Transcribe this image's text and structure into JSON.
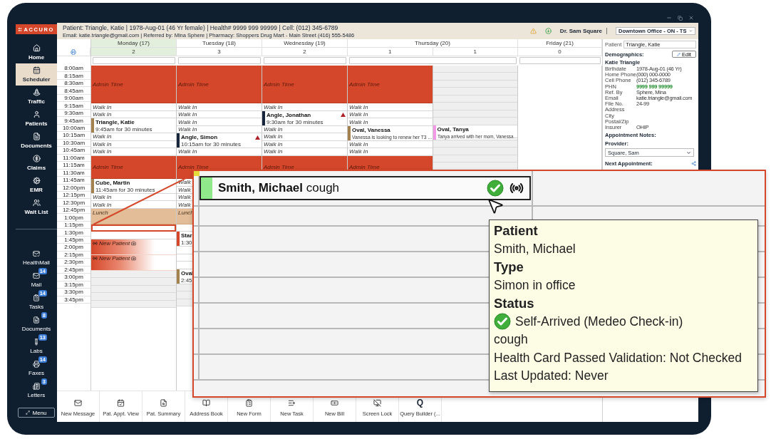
{
  "sidebar": {
    "logo": "ACCURO",
    "nav": [
      {
        "label": "Home",
        "selected": false
      },
      {
        "label": "Scheduler",
        "selected": true
      },
      {
        "label": "Traffic",
        "selected": false
      },
      {
        "label": "Patients",
        "selected": false
      },
      {
        "label": "Documents",
        "selected": false
      },
      {
        "label": "Claims",
        "selected": false
      },
      {
        "label": "EMR",
        "selected": false
      },
      {
        "label": "Wait List",
        "selected": false
      }
    ],
    "inbox": [
      {
        "label": "HealthMail"
      },
      {
        "label": "Mail",
        "badge": "14"
      },
      {
        "label": "Tasks",
        "badge": "14"
      },
      {
        "label": "Documents",
        "badge": "8"
      },
      {
        "label": "Labs",
        "badge": "13"
      },
      {
        "label": "Faxes",
        "badge": "14"
      },
      {
        "label": "Letters",
        "badge": "3"
      }
    ],
    "menu_button": "Menu"
  },
  "header": {
    "line1": "Patient: Triangle, Katie | 1978-Aug-01 (46 Yr female) | Health# 9999 999 99999 | Cell: (012) 345-6789",
    "line2": "Email: katie.triangle@gmail.com | Referred by: Mina Sphere | Pharmacy: Shoppers Drug Mart - Main Street (416) 555-5486",
    "provider": "Dr. Sam Square",
    "location": "Downtown Office - ON - TS"
  },
  "calendar": {
    "times": [
      "8:00am",
      "8:15am",
      "8:30am",
      "8:45am",
      "9:00am",
      "9:15am",
      "9:30am",
      "9:45am",
      "10:00am",
      "10:15am",
      "10:30am",
      "10:45am",
      "11:00am",
      "11:15am",
      "11:30am",
      "11:45am",
      "12:00pm",
      "12:15pm",
      "12:30pm",
      "12:45pm",
      "1:00pm",
      "1:15pm",
      "1:30pm",
      "1:45pm",
      "2:00pm",
      "2:15pm",
      "2:30pm",
      "2:45pm",
      "3:00pm",
      "3:15pm",
      "3:30pm",
      "3:45pm"
    ],
    "days": [
      {
        "label": "Monday (17)",
        "selected": true,
        "columns": [
          {
            "count": "2",
            "slots": [
              {
                "kind": "admin"
              },
              {
                "kind": "admin"
              },
              {
                "kind": "admin",
                "label": "Admin Time"
              },
              {
                "kind": "admin"
              },
              {
                "kind": "admin"
              },
              {
                "kind": "walkin",
                "label": "Walk In"
              },
              {
                "kind": "walkin",
                "label": "Walk In"
              },
              {
                "kind": "appt",
                "name": "Triangle, Katie",
                "color": "#a3824f",
                "alert": false
              },
              {
                "kind": "note",
                "text": "9:45am for 30 minutes"
              },
              {
                "kind": "walkin",
                "label": "Walk In"
              },
              {
                "kind": "walkin",
                "label": "Walk In"
              },
              {
                "kind": "walkin",
                "label": "Walk In"
              },
              {
                "kind": "admin"
              },
              {
                "kind": "admin",
                "label": "Admin Time"
              },
              {
                "kind": "admin"
              },
              {
                "kind": "appt",
                "name": "Cube, Martin",
                "color": "#a3824f",
                "alert": false
              },
              {
                "kind": "note",
                "text": "11:45am for 30 minutes"
              },
              {
                "kind": "walkin",
                "label": "Walk In"
              },
              {
                "kind": "walkin",
                "label": "Walk In"
              },
              {
                "kind": "lunch",
                "label": "Lunch"
              },
              {
                "kind": "lunch"
              },
              {
                "kind": "selected"
              },
              {
                "kind": "blank"
              },
              {
                "kind": "new",
                "label": "New Patient"
              },
              {
                "kind": "new"
              },
              {
                "kind": "new",
                "label": "New Patient"
              },
              {
                "kind": "new"
              },
              {
                "kind": "closed"
              },
              {
                "kind": "closed"
              },
              {
                "kind": "closed"
              },
              {
                "kind": "closed"
              },
              {
                "kind": "closed"
              }
            ]
          }
        ]
      },
      {
        "label": "Tuesday (18)",
        "selected": false,
        "columns": [
          {
            "count": "3",
            "slots": [
              {
                "kind": "admin"
              },
              {
                "kind": "admin"
              },
              {
                "kind": "admin",
                "label": "Admin Time"
              },
              {
                "kind": "admin"
              },
              {
                "kind": "admin"
              },
              {
                "kind": "walkin",
                "label": "Walk In"
              },
              {
                "kind": "walkin",
                "label": "Walk In"
              },
              {
                "kind": "walkin",
                "label": "Walk In"
              },
              {
                "kind": "walkin",
                "label": "Walk In"
              },
              {
                "kind": "appt",
                "name": "Angle, Simon",
                "color": "#17263a",
                "alert": true
              },
              {
                "kind": "note",
                "text": "10:15am for 30 minutes"
              },
              {
                "kind": "walkin",
                "label": "Walk In"
              },
              {
                "kind": "admin"
              },
              {
                "kind": "admin",
                "label": "Admin Time"
              },
              {
                "kind": "admin"
              },
              {
                "kind": "walkin",
                "label": "Walk"
              },
              {
                "kind": "walkin",
                "label": "Walk"
              },
              {
                "kind": "walkin",
                "label": "Walk"
              },
              {
                "kind": "walkin",
                "label": "Walk"
              },
              {
                "kind": "lunch",
                "label": "Lunch"
              },
              {
                "kind": "lunch"
              },
              {
                "kind": "blank"
              },
              {
                "kind": "appt",
                "name": "Star",
                "color": "#d5472a",
                "alert": false
              },
              {
                "kind": "note",
                "text": "1:30"
              },
              {
                "kind": "blank"
              },
              {
                "kind": "blank"
              },
              {
                "kind": "blank"
              },
              {
                "kind": "appt",
                "name": "Oval",
                "color": "#a3824f",
                "alert": false
              },
              {
                "kind": "note",
                "text": "2:45"
              },
              {
                "kind": "closed"
              },
              {
                "kind": "closed"
              },
              {
                "kind": "closed"
              }
            ]
          }
        ]
      },
      {
        "label": "Wednesday (19)",
        "selected": false,
        "columns": [
          {
            "count": "2",
            "slots": [
              {
                "kind": "admin"
              },
              {
                "kind": "admin"
              },
              {
                "kind": "admin",
                "label": "Admin Time"
              },
              {
                "kind": "admin"
              },
              {
                "kind": "admin"
              },
              {
                "kind": "walkin",
                "label": "Walk In"
              },
              {
                "kind": "appt",
                "name": "Angle, Jonathan",
                "color": "#17263a",
                "alert": true
              },
              {
                "kind": "note",
                "text": "9:30am for 30 minutes"
              },
              {
                "kind": "walkin",
                "label": "Walk In"
              },
              {
                "kind": "walkin",
                "label": "Walk In"
              },
              {
                "kind": "walkin",
                "label": "Walk In"
              },
              {
                "kind": "walkin",
                "label": "Walk In"
              },
              {
                "kind": "admin"
              },
              {
                "kind": "admin",
                "label": "Admin Time"
              },
              {
                "kind": "admin"
              }
            ]
          }
        ]
      },
      {
        "label": "Thursday (20)",
        "selected": false,
        "columns": [
          {
            "count": "1",
            "slots": [
              {
                "kind": "admin"
              },
              {
                "kind": "admin"
              },
              {
                "kind": "admin",
                "label": "Admin Time"
              },
              {
                "kind": "admin"
              },
              {
                "kind": "admin"
              },
              {
                "kind": "walkin",
                "label": "Walk In"
              },
              {
                "kind": "walkin",
                "label": "Walk In"
              },
              {
                "kind": "walkin",
                "label": "Walk In"
              },
              {
                "kind": "appt",
                "name": "Oval, Vanessa",
                "color": "#a3824f",
                "alert": false
              },
              {
                "kind": "note",
                "text": "Vanessa is looking to renew her T3  ..."
              },
              {
                "kind": "walkin",
                "label": "Walk In"
              },
              {
                "kind": "walkin",
                "label": "Walk In"
              },
              {
                "kind": "admin"
              },
              {
                "kind": "admin",
                "label": "Admin Time"
              },
              {
                "kind": "admin"
              }
            ]
          },
          {
            "count": "1",
            "slots": [
              {
                "kind": "closed"
              },
              {
                "kind": "closed"
              },
              {
                "kind": "closed"
              },
              {
                "kind": "closed"
              },
              {
                "kind": "closed"
              },
              {
                "kind": "closed"
              },
              {
                "kind": "closed"
              },
              {
                "kind": "closed"
              },
              {
                "kind": "appt",
                "name": "Oval, Tanya",
                "color": "#f29ae6",
                "alert": false
              },
              {
                "kind": "note",
                "text": "Tanya arrived with her mom, Vanessa..."
              },
              {
                "kind": "closed"
              },
              {
                "kind": "closed"
              },
              {
                "kind": "closed"
              },
              {
                "kind": "closed"
              }
            ]
          }
        ]
      },
      {
        "label": "Friday (21)",
        "selected": false,
        "columns": [
          {
            "count": "0"
          }
        ]
      }
    ]
  },
  "side_panel": {
    "patient_label": "Patient",
    "patient_value": "Triangle, Katie",
    "demographics_title": "Demographics:",
    "edit_label": "Edit",
    "name": "Katie Triangle",
    "fields": [
      {
        "label": "Birthdate",
        "value": "1978-Aug-01 (46 Yr)",
        "kind": "plain"
      },
      {
        "label": "Home Phone",
        "value": "(000) 000-0000",
        "kind": "plain"
      },
      {
        "label": "Cell Phone",
        "value": "(012) 345-6789",
        "kind": "plain"
      },
      {
        "label": "PHN",
        "value": "9999 999 99999",
        "kind": "health_number"
      },
      {
        "label": "Ref. By",
        "value": "Sphere, Mina",
        "kind": "plain"
      },
      {
        "label": "Email",
        "value": "katie.triangle@gmail.com",
        "kind": "plain"
      },
      {
        "label": "File No.",
        "value": "24-99",
        "kind": "plain"
      },
      {
        "label": "Address"
      },
      {
        "label": "City"
      },
      {
        "label": "Postal/Zip"
      },
      {
        "label": "Insurer",
        "value": "OHIP",
        "kind": "plain"
      }
    ],
    "appointment_notes": "Appointment Notes:",
    "provider_label": "Provider:",
    "provider_value": "Square, Sam",
    "next_appointment": "Next Appointment:"
  },
  "toolbar": [
    {
      "label": "New Message"
    },
    {
      "label": "Pat. Appt. View"
    },
    {
      "label": "Pat. Summary"
    },
    {
      "label": "Address Book"
    },
    {
      "label": "New Form"
    },
    {
      "label": "New Task"
    },
    {
      "label": "New Bill"
    },
    {
      "label": "Screen Lock"
    },
    {
      "label": "Query Builder (...",
      "glyph": "Q"
    }
  ],
  "callout": {
    "appointment": "**Smith, Michael** cough",
    "tooltip": [
      {
        "kind": "heading",
        "text": "Patient"
      },
      {
        "kind": "text",
        "text": "Smith, Michael"
      },
      {
        "kind": "heading",
        "text": "Type"
      },
      {
        "kind": "text",
        "text": "Simon in office"
      },
      {
        "kind": "heading",
        "text": "Status"
      },
      {
        "kind": "status",
        "text": "Self-Arrived (Medeo Check-in)"
      },
      {
        "kind": "text",
        "text": "cough"
      },
      {
        "kind": "text",
        "text": "Health Card Passed Validation: Not Checked"
      },
      {
        "kind": "text",
        "text": "Last Updated: Never"
      }
    ]
  }
}
